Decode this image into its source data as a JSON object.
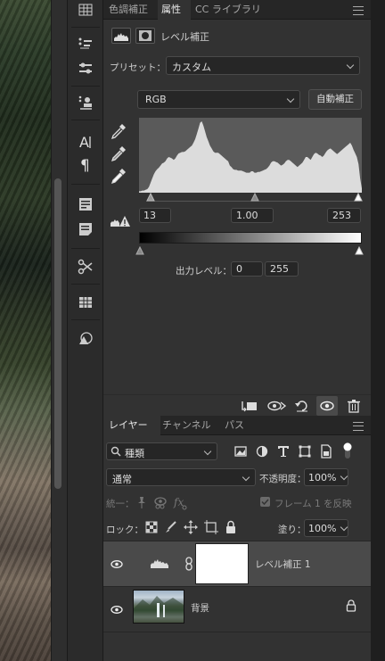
{
  "properties": {
    "tabs": [
      "色調補正",
      "属性",
      "CC ライブラリ"
    ],
    "active_tab": "属性",
    "panel_title": "レベル補正",
    "preset_label": "プリセット：",
    "preset_value": "カスタム",
    "channel_value": "RGB",
    "auto_button": "自動補正",
    "input_levels": {
      "shadow": "13",
      "midtone": "1.00",
      "highlight": "253"
    },
    "output_label": "出力レベル：",
    "output_levels": {
      "low": "0",
      "high": "255"
    }
  },
  "layers_panel": {
    "tabs": [
      "レイヤー",
      "チャンネル",
      "パス"
    ],
    "active_tab": "レイヤー",
    "filter_label": "種類",
    "blend_mode": "通常",
    "opacity_label": "不透明度：",
    "opacity_value": "100%",
    "unify_label": "統一：",
    "frame_label": "フレーム 1 を反映",
    "lock_label": "ロック：",
    "fill_label": "塗り：",
    "fill_value": "100%",
    "layers": [
      {
        "name": "レベル補正 1",
        "type": "adjustment",
        "visible": true,
        "selected": true
      },
      {
        "name": "背景",
        "type": "image",
        "visible": true,
        "locked": true
      }
    ]
  },
  "histogram": [
    2,
    2,
    3,
    3,
    4,
    5,
    8,
    14,
    20,
    26,
    30,
    33,
    35,
    38,
    41,
    42,
    44,
    48,
    50,
    49,
    48,
    46,
    48,
    52,
    55,
    56,
    57,
    57,
    58,
    60,
    62,
    64,
    66,
    70,
    75,
    82,
    90,
    98,
    100,
    94,
    86,
    78,
    72,
    66,
    62,
    58,
    56,
    56,
    56,
    54,
    52,
    50,
    48,
    46,
    44,
    38,
    36,
    33,
    32,
    32,
    31,
    31,
    31,
    30,
    29,
    28,
    28,
    28,
    30,
    30,
    28,
    28,
    29,
    29,
    30,
    31,
    32,
    33,
    35,
    38,
    42,
    44,
    44,
    43,
    42,
    40,
    38,
    39,
    41,
    44,
    46,
    46,
    44,
    42,
    40,
    38,
    36,
    38,
    40,
    42,
    46,
    50,
    50,
    48,
    46,
    50,
    54,
    56,
    55,
    53,
    52,
    50,
    52,
    56,
    59,
    61,
    62,
    60,
    58,
    56,
    54,
    56,
    58,
    60,
    62,
    64,
    66,
    68,
    70,
    66,
    60,
    55,
    50,
    40,
    20,
    6
  ],
  "colors": {
    "panel_bg": "#323232",
    "histogram_fill": "#dcdcdc",
    "histogram_bg": "#5a5a5a",
    "accent": "#ffffff"
  }
}
